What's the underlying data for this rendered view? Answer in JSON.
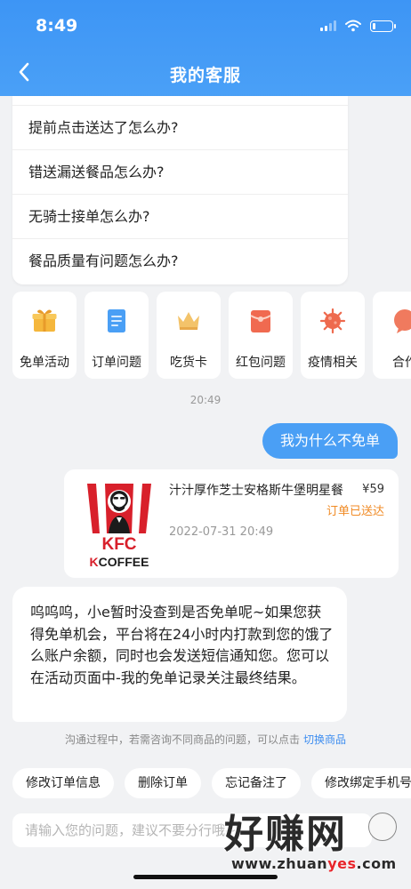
{
  "status_bar": {
    "time": "8:49",
    "battery_level": 0.15
  },
  "header": {
    "title": "我的客服",
    "back_icon": "chevron-left-icon"
  },
  "faq": {
    "items": [
      "提前点击送达了怎么办?",
      "错送漏送餐品怎么办?",
      "无骑士接单怎么办?",
      "餐品质量有问题怎么办?"
    ]
  },
  "quick_actions": [
    {
      "label": "免单活动",
      "icon": "gift-icon",
      "color": "#f5b73c"
    },
    {
      "label": "订单问题",
      "icon": "document-icon",
      "color": "#4a9ff5"
    },
    {
      "label": "吃货卡",
      "icon": "crown-icon",
      "color": "#f3c36a"
    },
    {
      "label": "红包问题",
      "icon": "red-packet-icon",
      "color": "#f06a50"
    },
    {
      "label": "疫情相关",
      "icon": "virus-icon",
      "color": "#ee6a4e"
    },
    {
      "label": "合作",
      "icon": "chat-bubble-icon",
      "color": "#f07a5e"
    }
  ],
  "chat": {
    "timestamp": "20:49",
    "user_message": "我为什么不免单",
    "order": {
      "name": "汁汁厚作芝士安格斯牛堡明星餐",
      "price": "¥59",
      "status": "订单已送达",
      "date": "2022-07-31 20:49",
      "logo": {
        "brand": "KFC",
        "sub_brand": "KCOFFEE"
      }
    },
    "bot_message": "呜呜呜，小e暂时没查到是否免单呢~如果您获得免单机会，平台将在24小时内打款到您的饿了么账户余额，同时也会发送短信通知您。您可以在活动页面中-我的免单记录关注最终结果。",
    "hint": "沟通过程中，若需咨询不同商品的问题，可以点击",
    "hint_link": "切换商品"
  },
  "chips": [
    "修改订单信息",
    "删除订单",
    "忘记备注了",
    "修改绑定手机号"
  ],
  "input": {
    "placeholder": "请输入您的问题，建议不要分行哦~"
  },
  "watermark": {
    "text": "好赚网",
    "url_pre": "www.zhuan",
    "url_mid": "yes",
    "url_post": ".com"
  },
  "colors": {
    "header": "#3d95f5",
    "accent": "#4a9ff5",
    "status_orange": "#f08a24"
  }
}
